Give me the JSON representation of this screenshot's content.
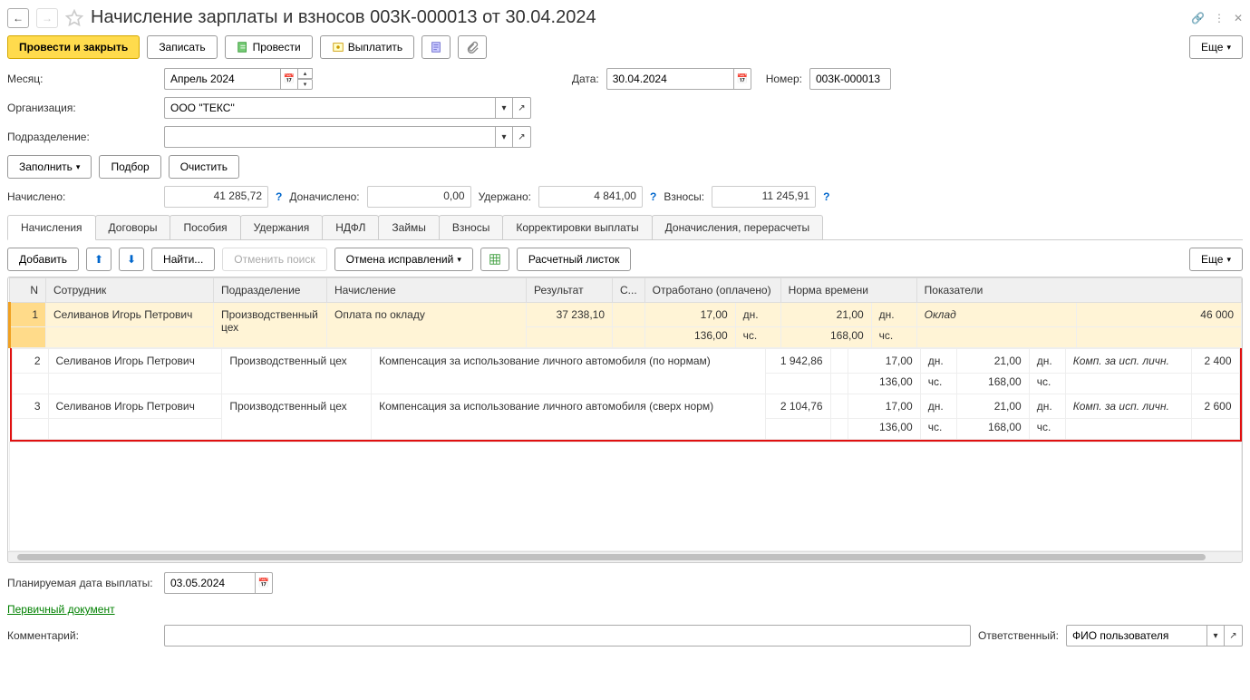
{
  "header": {
    "title": "Начисление зарплаты и взносов 003К-000013 от 30.04.2024"
  },
  "toolbar": {
    "post_close": "Провести и закрыть",
    "save": "Записать",
    "post": "Провести",
    "pay": "Выплатить",
    "more": "Еще"
  },
  "form": {
    "month_label": "Месяц:",
    "month_value": "Апрель 2024",
    "date_label": "Дата:",
    "date_value": "30.04.2024",
    "number_label": "Номер:",
    "number_value": "003К-000013",
    "org_label": "Организация:",
    "org_value": "ООО \"ТЕКС\"",
    "dept_label": "Подразделение:",
    "dept_value": "",
    "fill": "Заполнить",
    "pick": "Подбор",
    "clear": "Очистить"
  },
  "totals": {
    "accrued_label": "Начислено:",
    "accrued": "41 285,72",
    "extra_label": "Доначислено:",
    "extra": "0,00",
    "withheld_label": "Удержано:",
    "withheld": "4 841,00",
    "contrib_label": "Взносы:",
    "contrib": "11 245,91"
  },
  "tabs": [
    "Начисления",
    "Договоры",
    "Пособия",
    "Удержания",
    "НДФЛ",
    "Займы",
    "Взносы",
    "Корректировки выплаты",
    "Доначисления, перерасчеты"
  ],
  "table_toolbar": {
    "add": "Добавить",
    "find": "Найти...",
    "cancel_search": "Отменить поиск",
    "cancel_fixes": "Отмена исправлений",
    "payslip": "Расчетный листок",
    "more": "Еще"
  },
  "columns": {
    "n": "N",
    "employee": "Сотрудник",
    "dept": "Подразделение",
    "accrual": "Начисление",
    "result": "Результат",
    "c": "С...",
    "worked": "Отработано (оплачено)",
    "norm": "Норма времени",
    "indicators": "Показатели"
  },
  "rows": [
    {
      "n": "1",
      "employee": "Селиванов Игорь Петрович",
      "dept": "Производственный цех",
      "accrual": "Оплата по окладу",
      "result": "37 238,10",
      "worked_days": "17,00",
      "worked_days_u": "дн.",
      "norm_days": "21,00",
      "norm_days_u": "дн.",
      "worked_hrs": "136,00",
      "worked_hrs_u": "чс.",
      "norm_hrs": "168,00",
      "norm_hrs_u": "чс.",
      "ind_name": "Оклад",
      "ind_val": "46 000",
      "highlight": true
    },
    {
      "n": "2",
      "employee": "Селиванов Игорь Петрович",
      "dept": "Производственный цех",
      "accrual": "Компенсация за использование личного автомобиля (по нормам)",
      "result": "1 942,86",
      "worked_days": "17,00",
      "worked_days_u": "дн.",
      "norm_days": "21,00",
      "norm_days_u": "дн.",
      "worked_hrs": "136,00",
      "worked_hrs_u": "чс.",
      "norm_hrs": "168,00",
      "norm_hrs_u": "чс.",
      "ind_name": "Комп. за исп. личн.",
      "ind_val": "2 400"
    },
    {
      "n": "3",
      "employee": "Селиванов Игорь Петрович",
      "dept": "Производственный цех",
      "accrual": "Компенсация за использование личного автомобиля (сверх норм)",
      "result": "2 104,76",
      "worked_days": "17,00",
      "worked_days_u": "дн.",
      "norm_days": "21,00",
      "norm_days_u": "дн.",
      "worked_hrs": "136,00",
      "worked_hrs_u": "чс.",
      "norm_hrs": "168,00",
      "norm_hrs_u": "чс.",
      "ind_name": "Комп. за исп. личн.",
      "ind_val": "2 600"
    }
  ],
  "footer": {
    "planned_date_label": "Планируемая дата выплаты:",
    "planned_date": "03.05.2024",
    "primary_doc": "Первичный документ",
    "comment_label": "Комментарий:",
    "comment": "",
    "responsible_label": "Ответственный:",
    "responsible": "ФИО пользователя"
  }
}
